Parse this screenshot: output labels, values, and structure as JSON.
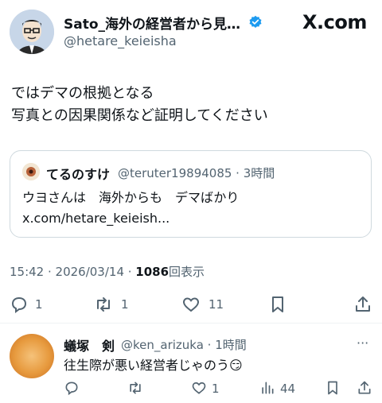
{
  "header": {
    "display_name": "Sato_海外の経営者から見…",
    "handle": "@hetare_keieisha",
    "site": "X.com"
  },
  "tweet": {
    "text": "ではデマの根拠となる\n写真との因果関係など証明してください",
    "timestamp": "15:42 · 2026/03/14 · ",
    "views": "1086",
    "views_label": "回表示",
    "replies": "1",
    "retweets": "1",
    "likes": "11"
  },
  "quote": {
    "name": "てるのすけ",
    "handle": "@teruter19894085 · 3時間",
    "text": "ウヨさんは　海外からも　デマばかり x.com/hetare_keieish..."
  },
  "reply": {
    "name": "蟻塚　剣",
    "handle": "@ken_arizuka · 1時間",
    "text": "往生際が悪い経営者じゃのう😏",
    "likes": "1",
    "views": "44"
  },
  "colors": {
    "verified": "#1d9bf0",
    "muted": "#536471",
    "text": "#0f1419"
  }
}
